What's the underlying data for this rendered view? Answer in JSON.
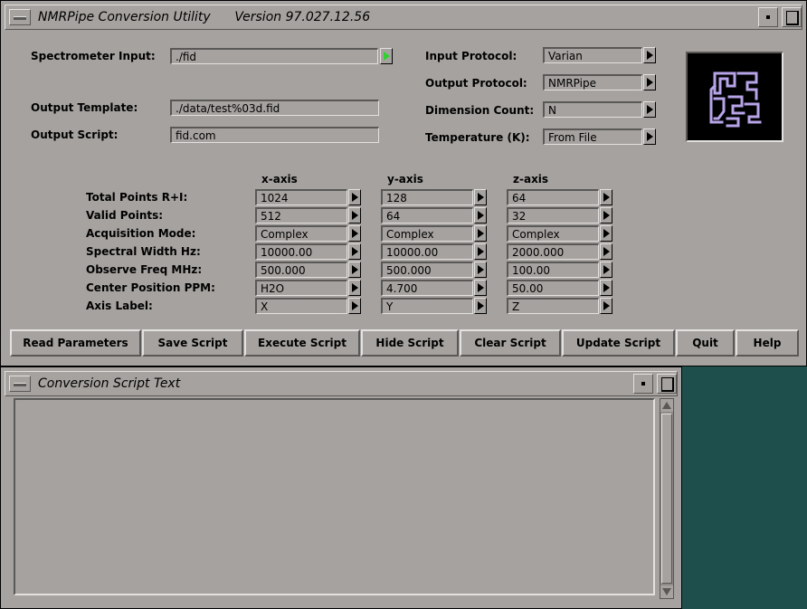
{
  "main_window": {
    "title": "NMRPipe Conversion Utility      Version 97.027.12.56",
    "spectrometer_input": {
      "label": "Spectrometer Input:",
      "value": "./fid"
    },
    "output_template": {
      "label": "Output Template:",
      "value": "./data/test%03d.fid"
    },
    "output_script": {
      "label": "Output Script:",
      "value": "fid.com"
    },
    "input_protocol": {
      "label": "Input Protocol:",
      "value": "Varian"
    },
    "output_protocol": {
      "label": "Output Protocol:",
      "value": "NMRPipe"
    },
    "dimension_count": {
      "label": "Dimension Count:",
      "value": "N"
    },
    "temperature": {
      "label": "Temperature (K):",
      "value": "From File"
    },
    "axes": {
      "headers": [
        "x-axis",
        "y-axis",
        "z-axis"
      ],
      "rows": [
        {
          "label": "Total Points R+I:",
          "values": [
            "1024",
            "128",
            "64"
          ]
        },
        {
          "label": "Valid Points:",
          "values": [
            "512",
            "64",
            "32"
          ]
        },
        {
          "label": "Acquisition Mode:",
          "values": [
            "Complex",
            "Complex",
            "Complex"
          ]
        },
        {
          "label": "Spectral Width Hz:",
          "values": [
            "10000.00",
            "10000.00",
            "2000.000"
          ]
        },
        {
          "label": "Observe Freq MHz:",
          "values": [
            "500.000",
            "500.000",
            "100.00"
          ]
        },
        {
          "label": "Center Position PPM:",
          "values": [
            "H2O",
            "4.700",
            "50.00"
          ]
        },
        {
          "label": "Axis Label:",
          "values": [
            "X",
            "Y",
            "Z"
          ]
        }
      ]
    },
    "buttons": [
      "Read Parameters",
      "Save Script",
      "Execute Script",
      "Hide Script",
      "Clear Script",
      "Update Script",
      "Quit",
      "Help"
    ]
  },
  "script_window": {
    "title": "Conversion Script Text"
  },
  "colors": {
    "window_bg": "#a6a2a0",
    "desktop_bg": "#1e4f4d",
    "logo_glyph": "#b7a3e8",
    "green_arrow": "#2fd12f"
  }
}
